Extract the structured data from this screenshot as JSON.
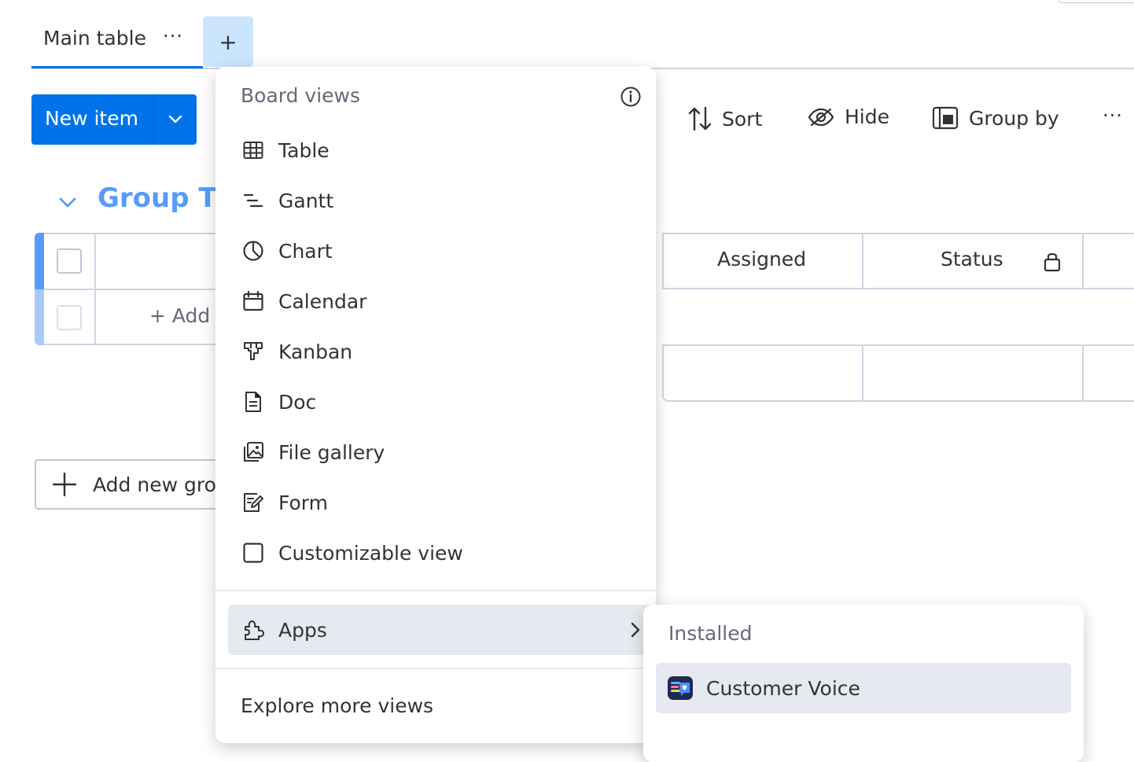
{
  "tabs": {
    "main_label": "Main table",
    "more_icon": "more-dots-icon",
    "add_label": "+"
  },
  "toolbar": {
    "new_item_label": "New item",
    "sort_label": "Sort",
    "hide_label": "Hide",
    "group_by_label": "Group by",
    "more_label": "···"
  },
  "group": {
    "title": "Group Ti",
    "add_row_label": "+ Add",
    "add_group_label": "Add new gro"
  },
  "columns": {
    "assigned": "Assigned",
    "status": "Status"
  },
  "menu": {
    "header": "Board views",
    "items": [
      {
        "label": "Table",
        "icon": "table-icon"
      },
      {
        "label": "Gantt",
        "icon": "gantt-icon"
      },
      {
        "label": "Chart",
        "icon": "chart-icon"
      },
      {
        "label": "Calendar",
        "icon": "calendar-icon"
      },
      {
        "label": "Kanban",
        "icon": "kanban-icon"
      },
      {
        "label": "Doc",
        "icon": "doc-icon"
      },
      {
        "label": "File gallery",
        "icon": "file-gallery-icon"
      },
      {
        "label": "Form",
        "icon": "form-icon"
      },
      {
        "label": "Customizable view",
        "icon": "customizable-view-icon"
      }
    ],
    "apps_label": "Apps",
    "explore_label": "Explore more views"
  },
  "submenu": {
    "header": "Installed",
    "items": [
      {
        "label": "Customer Voice",
        "icon": "customer-voice-app-icon"
      }
    ]
  },
  "colors": {
    "primary": "#0073ea",
    "group_color": "#579bfc",
    "add_view_bg": "#cce5ff",
    "hover_bg": "#e6e9ef"
  }
}
